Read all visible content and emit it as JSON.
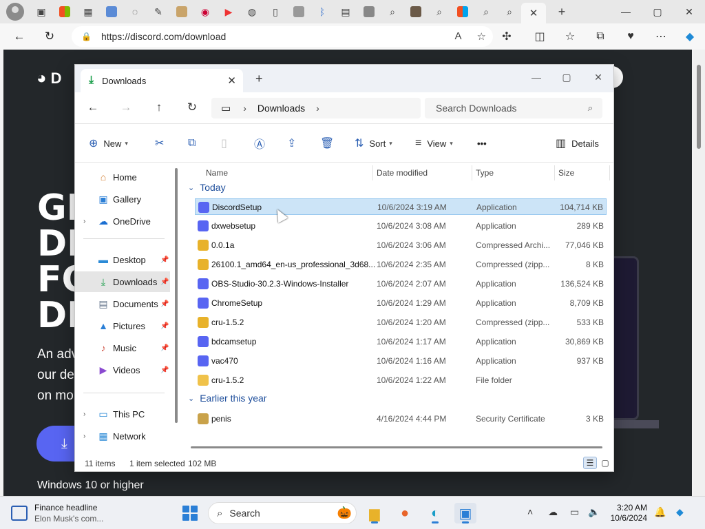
{
  "browser": {
    "url": "https://discord.com/download",
    "window_controls": {
      "minimize": "—",
      "maximize": "▢",
      "close": "✕"
    }
  },
  "page": {
    "logo_text": "D",
    "hero_lines": [
      "GI",
      "DI",
      "FO",
      "DI"
    ],
    "subtitle_lines": [
      "An adv",
      "our de",
      "on mo"
    ],
    "requirement": "Windows 10 or higher"
  },
  "explorer": {
    "tab_title": "Downloads",
    "breadcrumb": "Downloads",
    "search_placeholder": "Search Downloads",
    "commands": {
      "new": "New",
      "sort": "Sort",
      "view": "View",
      "more": "•••",
      "details": "Details"
    },
    "sidebar": [
      {
        "label": "Home"
      },
      {
        "label": "Gallery"
      },
      {
        "label": "OneDrive"
      },
      {
        "label": "Desktop"
      },
      {
        "label": "Downloads"
      },
      {
        "label": "Documents"
      },
      {
        "label": "Pictures"
      },
      {
        "label": "Music"
      },
      {
        "label": "Videos"
      },
      {
        "label": "This PC"
      },
      {
        "label": "Network"
      }
    ],
    "columns": {
      "name": "Name",
      "date": "Date modified",
      "type": "Type",
      "size": "Size"
    },
    "groups": [
      {
        "title": "Today",
        "files": [
          {
            "name": "DiscordSetup",
            "date": "10/6/2024 3:19 AM",
            "type": "Application",
            "size": "104,714 KB",
            "selected": true
          },
          {
            "name": "dxwebsetup",
            "date": "10/6/2024 3:08 AM",
            "type": "Application",
            "size": "289 KB"
          },
          {
            "name": "0.0.1a",
            "date": "10/6/2024 3:06 AM",
            "type": "Compressed Archi...",
            "size": "77,046 KB"
          },
          {
            "name": "26100.1_amd64_en-us_professional_3d68...",
            "date": "10/6/2024 2:35 AM",
            "type": "Compressed (zipp...",
            "size": "8 KB"
          },
          {
            "name": "OBS-Studio-30.2.3-Windows-Installer",
            "date": "10/6/2024 2:07 AM",
            "type": "Application",
            "size": "136,524 KB"
          },
          {
            "name": "ChromeSetup",
            "date": "10/6/2024 1:29 AM",
            "type": "Application",
            "size": "8,709 KB"
          },
          {
            "name": "cru-1.5.2",
            "date": "10/6/2024 1:20 AM",
            "type": "Compressed (zipp...",
            "size": "533 KB"
          },
          {
            "name": "bdcamsetup",
            "date": "10/6/2024 1:17 AM",
            "type": "Application",
            "size": "30,869 KB"
          },
          {
            "name": "vac470",
            "date": "10/6/2024 1:16 AM",
            "type": "Application",
            "size": "937 KB"
          },
          {
            "name": "cru-1.5.2",
            "date": "10/6/2024 1:22 AM",
            "type": "File folder",
            "size": ""
          }
        ]
      },
      {
        "title": "Earlier this year",
        "files": [
          {
            "name": "penis",
            "date": "4/16/2024 4:44 PM",
            "type": "Security Certificate",
            "size": "3 KB"
          }
        ]
      }
    ],
    "status": {
      "count": "11 items",
      "selection": "1 item selected",
      "size": "102 MB"
    }
  },
  "taskbar": {
    "news_title": "Finance headline",
    "news_sub": "Elon Musk's com...",
    "search_label": "Search",
    "time": "3:20 AM",
    "date": "10/6/2024"
  },
  "colors": {
    "accent": "#2b5fb3",
    "selection": "#cce4f7",
    "discord_blurple": "#5865f2",
    "page_bg": "#23272a"
  }
}
